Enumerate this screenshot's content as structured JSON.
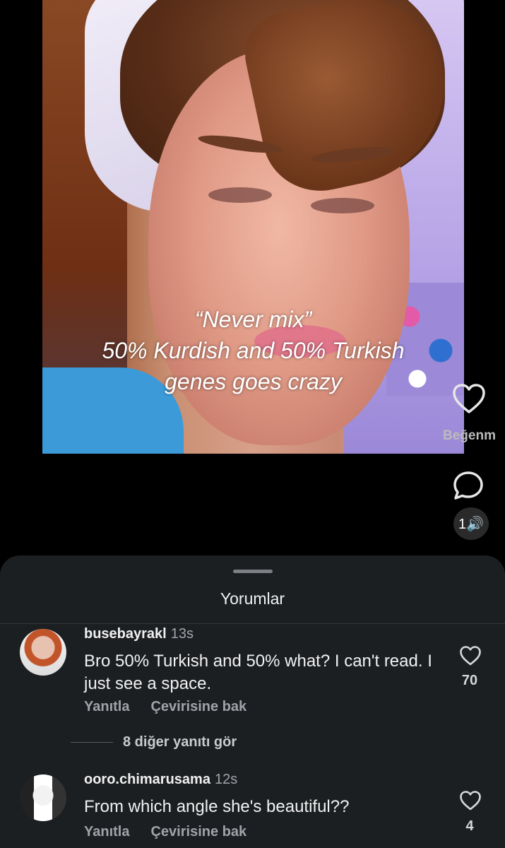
{
  "video": {
    "caption_lines": [
      "“Never mix”",
      "50% Kurdish and 50% Turkish",
      "genes goes crazy"
    ]
  },
  "side_actions": {
    "like_label": "Beğenm",
    "sound_label": "1🔊"
  },
  "comments_sheet": {
    "title": "Yorumlar",
    "comments": [
      {
        "username": "busebayrakl",
        "time": "13s",
        "text": "Bro 50% Turkish and 50% what? I can't read. I just see a space.",
        "reply_label": "Yanıtla",
        "translate_label": "Çevirisine bak",
        "likes": "70",
        "more_replies": "8 diğer yanıtı gör"
      },
      {
        "username": "ooro.chimarusama",
        "time": "12s",
        "text": "From which angle she's beautiful??",
        "reply_label": "Yanıtla",
        "translate_label": "Çevirisine bak",
        "likes": "4"
      }
    ]
  },
  "colors": {
    "sheet_bg": "#1c1f22",
    "text_primary": "#f1f1f1",
    "text_secondary": "#a0a4a8"
  }
}
